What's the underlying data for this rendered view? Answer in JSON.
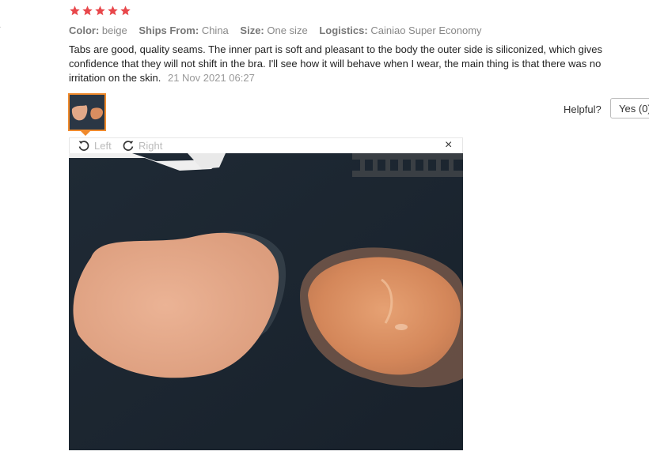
{
  "review": {
    "stars": 5,
    "star_color": "#e8474b",
    "attributes": [
      {
        "key": "Color:",
        "value": "beige"
      },
      {
        "key": "Ships From:",
        "value": "China"
      },
      {
        "key": "Size:",
        "value": "One size"
      },
      {
        "key": "Logistics:",
        "value": "Cainiao Super Economy"
      }
    ],
    "text": "Tabs are good, quality seams. The inner part is soft and pleasant to the body the outer side is siliconized, which gives confidence that they will not shift in the bra. I'll see how it will behave when I wear, the main thing is that there was no irritation on the skin.",
    "date": "21 Nov 2021 06:27"
  },
  "helpful": {
    "label": "Helpful?",
    "yes_label": "Yes (0)"
  },
  "viewer": {
    "rotate_left": "Left",
    "rotate_right": "Right",
    "close": "×"
  },
  "colors": {
    "thumb_border": "#f08a2c",
    "photo_background": "#1e2833",
    "pad_fabric": "#e4a98a",
    "pad_silicone": "#d88a5e"
  }
}
